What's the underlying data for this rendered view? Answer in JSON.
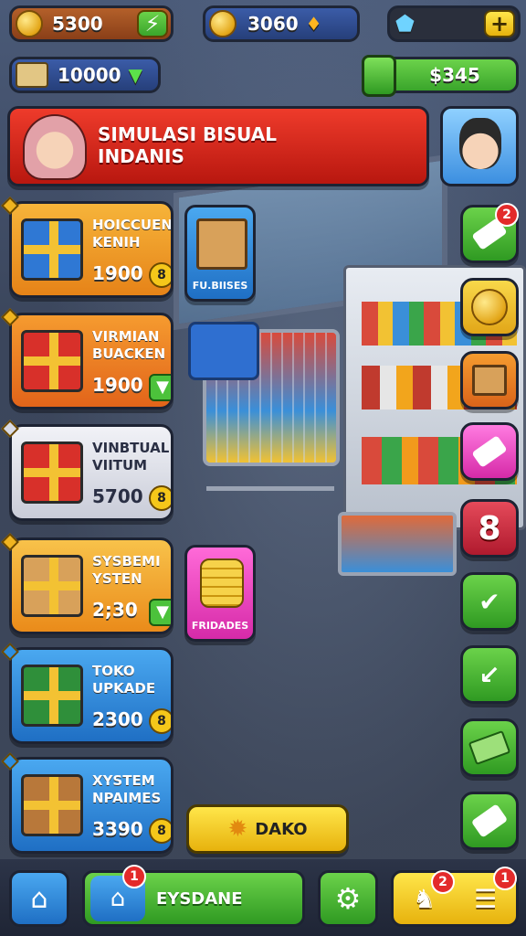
{
  "hud": {
    "coins": "5300",
    "gems": "3060",
    "bank": "10000",
    "cash": "$345",
    "plus": "+"
  },
  "banner": {
    "title": "SIMULASI BISUAL\nINDANIS"
  },
  "cards": [
    {
      "title": "HOICCUEN\nKENIH",
      "price": "1900",
      "badge": "8",
      "accent": "#f29a1c"
    },
    {
      "title": "VIRMIAN\nBUACKEN",
      "price": "1900",
      "badge": "arrow",
      "accent": "#f07a1a"
    },
    {
      "title": "VINBTUAL\nVIITUM",
      "price": "5700",
      "badge": "8",
      "accent": "#d9dbe6"
    },
    {
      "title": "SYSBEMI\nYSTEN",
      "price": "2;30",
      "badge": "arrow",
      "accent": "#f2a51c"
    },
    {
      "title": "TOKO\nUPKADE",
      "price": "2300",
      "badge": "8",
      "accent": "#2d8fe0"
    },
    {
      "title": "XYSTEM\nNPAIMES",
      "price": "3390",
      "badge": "8",
      "accent": "#2d8fe0"
    }
  ],
  "mini": {
    "box": "FU.BIISES",
    "coins": "FRIDADES"
  },
  "side": {
    "eight": "8",
    "notif_top": "2"
  },
  "action_button": "DAKO",
  "nav": {
    "center_label": "EYSDANE",
    "home_badge": "1",
    "right_badge_a": "2",
    "right_badge_b": "1"
  },
  "colors": {
    "red_banner": "#d7261e",
    "green": "#4cc23b",
    "yellow": "#f5c71a"
  }
}
